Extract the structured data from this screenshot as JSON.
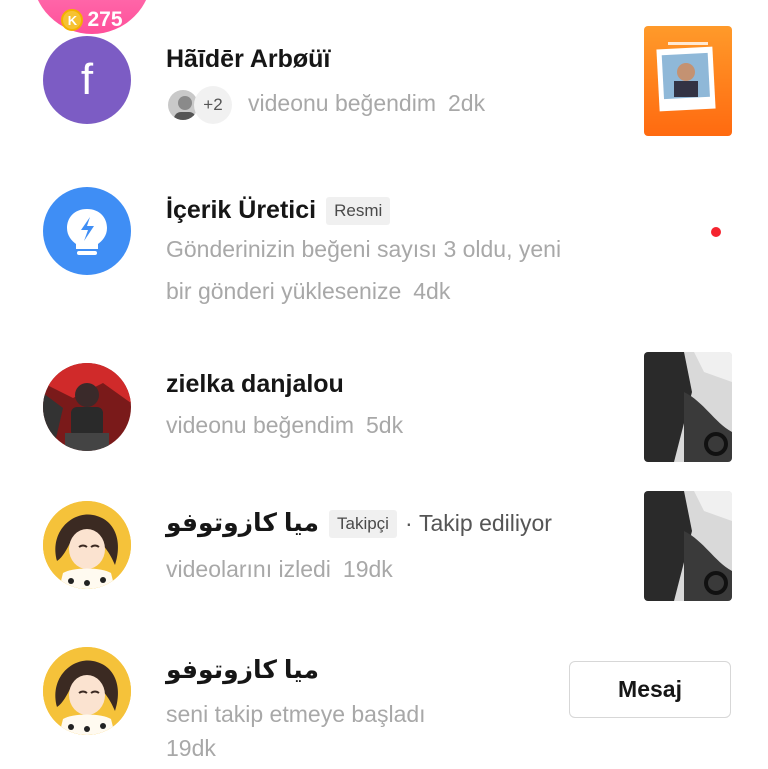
{
  "header": {
    "coin_symbol": "K",
    "coin_count": "275"
  },
  "notifications": [
    {
      "name": "Hãīdēr Arbøüï",
      "avatar_letter": "f",
      "avatar_color": "#7c5cc4",
      "extra_count": "+2",
      "text": "videonu beğendim",
      "time": "2dk"
    },
    {
      "name": "İçerik Üretici",
      "tag": "Resmi",
      "avatar_color": "#3f8ef5",
      "text_line1": "Gönderinizin beğeni sayısı 3 oldu, yeni",
      "text_line2": "bir gönderi yüklesenize",
      "time": "4dk",
      "unread": true
    },
    {
      "name": "zielka danjalou",
      "text": "videonu beğendim",
      "time": "5dk"
    },
    {
      "name": "ميا كازوتوفو",
      "tag": "Takipçi",
      "follow_status": "· Takip ediliyor",
      "text": "videolarını izledi",
      "time": "19dk"
    },
    {
      "name": "ميا كازوتوفو",
      "text": "seni takip etmeye başladı",
      "time": "19dk",
      "button_label": "Mesaj"
    }
  ]
}
